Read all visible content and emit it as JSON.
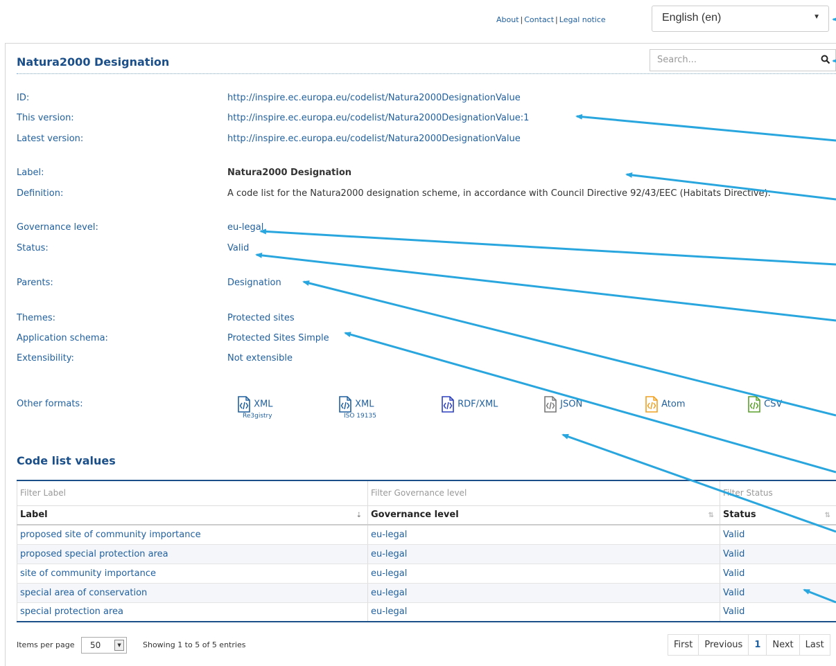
{
  "topnav": {
    "about": "About",
    "contact": "Contact",
    "legal": "Legal notice",
    "sep": "|"
  },
  "language": {
    "selected": "English (en)"
  },
  "search": {
    "placeholder": "Search..."
  },
  "title": "Natura2000 Designation",
  "meta": {
    "id_label": "ID:",
    "id_value": "http://inspire.ec.europa.eu/codelist/Natura2000DesignationValue",
    "version_label": "This version:",
    "version_value": "http://inspire.ec.europa.eu/codelist/Natura2000DesignationValue:1",
    "latest_label": "Latest version:",
    "latest_value": "http://inspire.ec.europa.eu/codelist/Natura2000DesignationValue",
    "label_label": "Label:",
    "label_value": "Natura2000 Designation",
    "definition_label": "Definition:",
    "definition_value": "A code list for the Natura2000 designation scheme, in accordance with Council Directive 92/43/EEC (Habitats Directive).",
    "governance_label": "Governance level:",
    "governance_value": "eu-legal",
    "status_label": "Status:",
    "status_value": "Valid",
    "parents_label": "Parents:",
    "parents_value": "Designation",
    "themes_label": "Themes:",
    "themes_value": "Protected sites",
    "schema_label": "Application schema:",
    "schema_value": "Protected Sites Simple",
    "extensibility_label": "Extensibility:",
    "extensibility_value": "Not extensible",
    "formats_label": "Other formats:"
  },
  "formats": [
    {
      "label": "XML",
      "sub": "Re3gistry",
      "color": "#1f5f9e"
    },
    {
      "label": "XML",
      "sub": "ISO 19135",
      "color": "#1f5f9e"
    },
    {
      "label": "RDF/XML",
      "sub": "",
      "color": "#2a3fbf"
    },
    {
      "label": "JSON",
      "sub": "",
      "color": "#777777"
    },
    {
      "label": "Atom",
      "sub": "",
      "color": "#f0a020"
    },
    {
      "label": "CSV",
      "sub": "",
      "color": "#5aa02c"
    }
  ],
  "section_title": "Code list values",
  "table": {
    "filters": [
      "Filter Label",
      "Filter Governance level",
      "Filter Status"
    ],
    "headers": [
      "Label",
      "Governance level",
      "Status"
    ],
    "rows": [
      [
        "proposed site of community importance",
        "eu-legal",
        "Valid"
      ],
      [
        "proposed special protection area",
        "eu-legal",
        "Valid"
      ],
      [
        "site of community importance",
        "eu-legal",
        "Valid"
      ],
      [
        "special area of conservation",
        "eu-legal",
        "Valid"
      ],
      [
        "special protection area",
        "eu-legal",
        "Valid"
      ]
    ]
  },
  "footer": {
    "items_per_page": "Items per page",
    "page_size": "50",
    "showing": "Showing 1 to 5 of 5 entries",
    "pager": [
      "First",
      "Previous",
      "1",
      "Next",
      "Last"
    ]
  },
  "colors": {
    "accent": "#1b4f8a",
    "link": "#1f5f9e",
    "arrow": "#2aa6de"
  }
}
